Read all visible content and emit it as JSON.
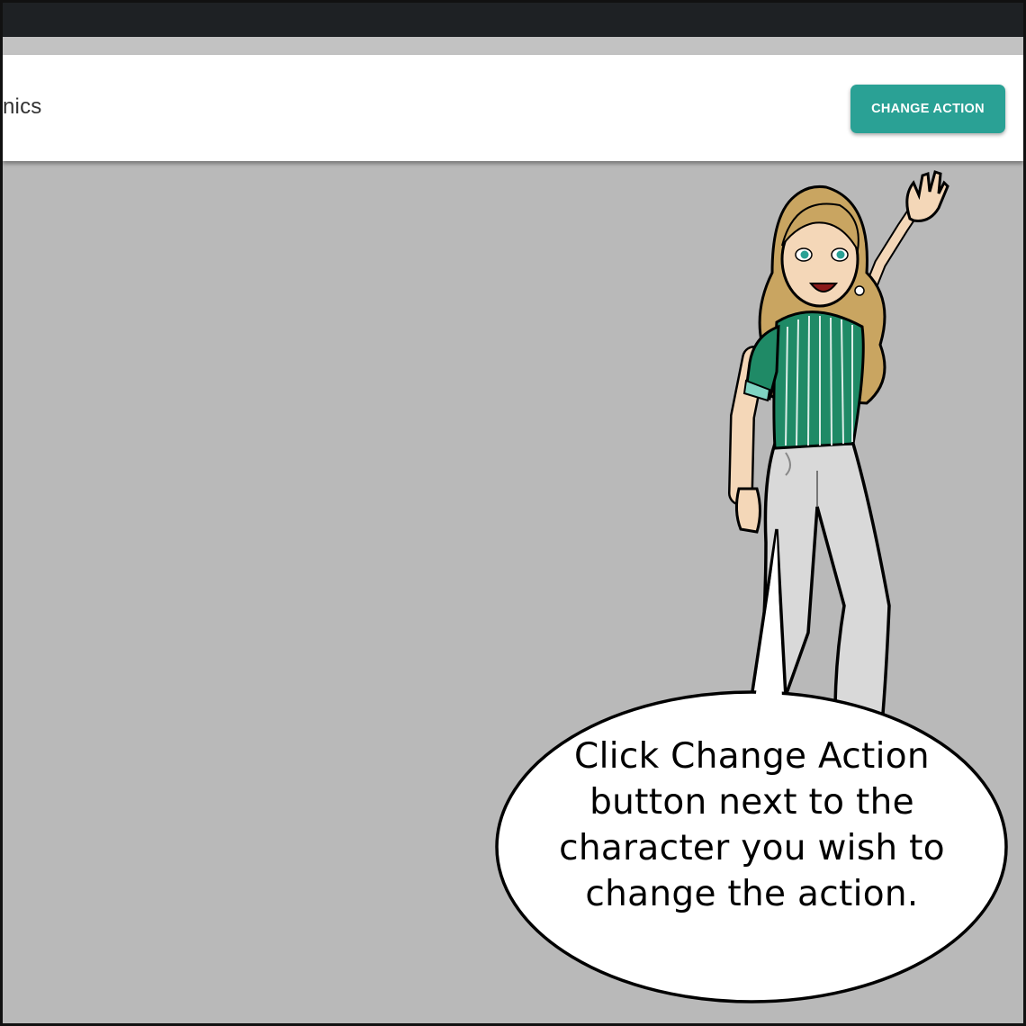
{
  "toolbar": {
    "title_fragment": "nics",
    "change_action_label": "CHANGE ACTION"
  },
  "speech_bubble": {
    "text": "Click Change Action button next to the character you wish to change the action."
  },
  "colors": {
    "top_bar": "#1e2124",
    "canvas_background": "#b9b9b9",
    "button_accent": "#2aa195",
    "shirt_green": "#1f8a66",
    "pants_gray": "#d9d9d9"
  },
  "icons": [
    "waving-woman-character",
    "speech-bubble"
  ]
}
